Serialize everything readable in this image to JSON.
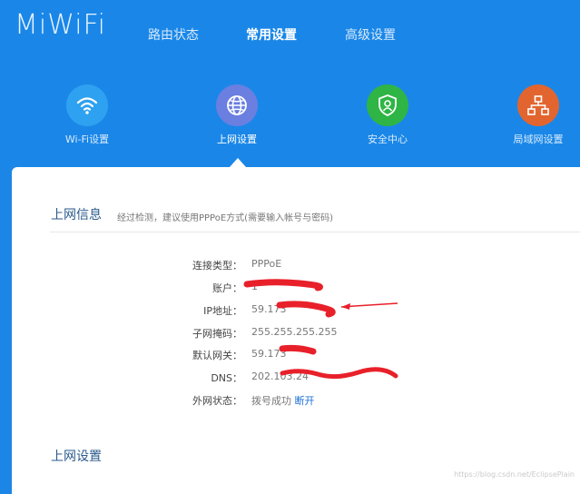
{
  "brand": {
    "logo_text": "MiWiFi"
  },
  "topnav": [
    {
      "label": "路由状态",
      "active": false
    },
    {
      "label": "常用设置",
      "active": true
    },
    {
      "label": "高级设置",
      "active": false
    }
  ],
  "icon_nav": [
    {
      "label": "Wi-Fi设置",
      "icon": "wifi-icon",
      "color": "#2ea1f0",
      "active": false
    },
    {
      "label": "上网设置",
      "icon": "globe-icon",
      "color": "#6a7fe0",
      "active": true
    },
    {
      "label": "安全中心",
      "icon": "shield-user-icon",
      "color": "#2fb545",
      "active": false
    },
    {
      "label": "局域网设置",
      "icon": "network-icon",
      "color": "#e2652f",
      "active": false
    }
  ],
  "internet_info": {
    "title": "上网信息",
    "hint": "经过检测，建议使用PPPoE方式(需要输入帐号与密码)",
    "rows": [
      {
        "label": "连接类型：",
        "value": "PPPoE"
      },
      {
        "label": "账户：",
        "value": "1"
      },
      {
        "label": "IP地址：",
        "value": "59.173"
      },
      {
        "label": "子网掩码：",
        "value": "255.255.255.255"
      },
      {
        "label": "默认网关：",
        "value": "59.173"
      },
      {
        "label": "DNS：",
        "value": "202.103.24"
      },
      {
        "label": "外网状态：",
        "value": "拨号成功",
        "action": "断开"
      }
    ]
  },
  "internet_settings": {
    "title": "上网设置"
  },
  "watermark": "https://blog.csdn.net/EclipsePlain",
  "colors": {
    "header_bg": "#1a87e8",
    "link": "#1a6fd6",
    "redaction": "#e8202a"
  }
}
